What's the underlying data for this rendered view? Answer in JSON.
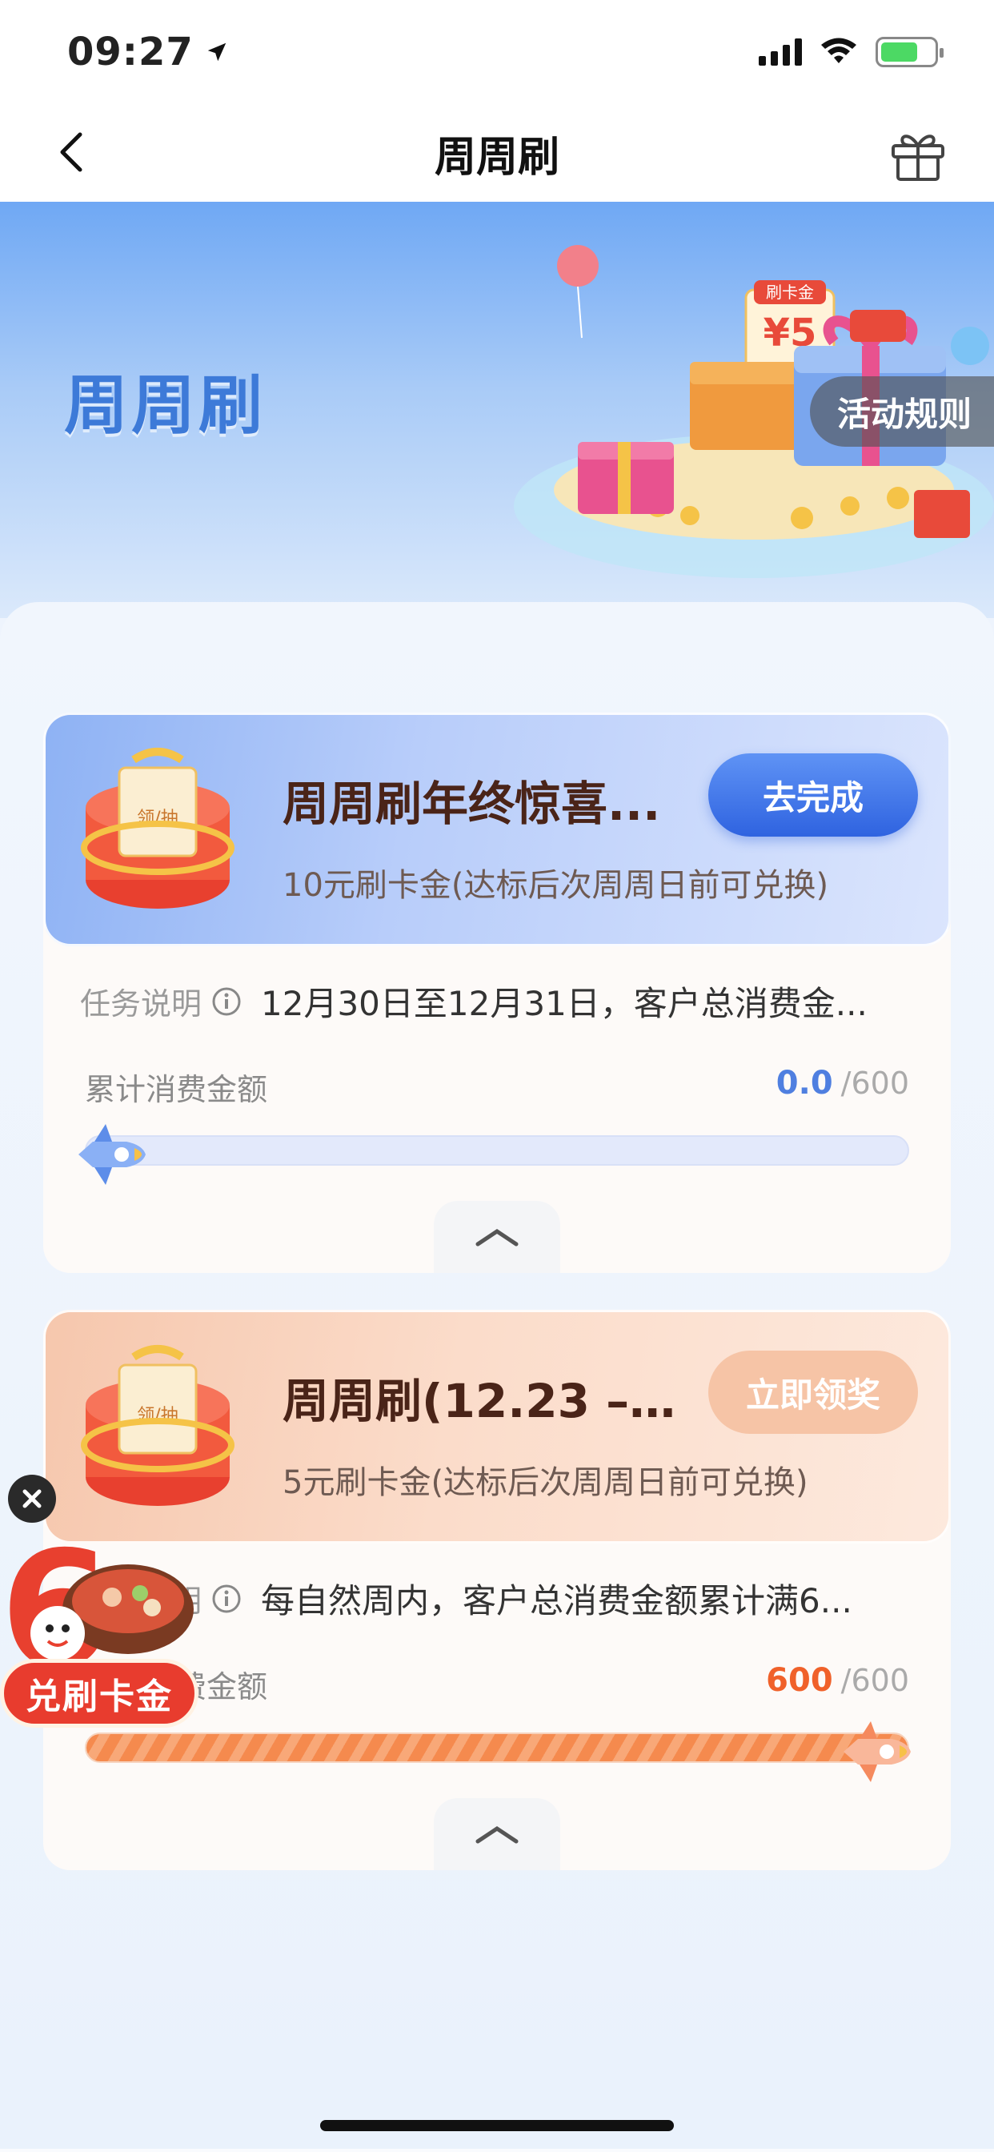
{
  "status_bar": {
    "time": "09:27"
  },
  "nav": {
    "title": "周周刷"
  },
  "hero": {
    "title": "周周刷",
    "rules_button": "活动规则",
    "art_ticket_label": "刷卡金",
    "art_amount": "¥5"
  },
  "tasks": [
    {
      "title": "周周刷年终惊喜...",
      "subtitle": "10元刷卡金(达标后次周周日前可兑换)",
      "button": "去完成",
      "desc_label": "任务说明",
      "desc_text": "12月30日至12月31日，客户总消费金...",
      "progress_label": "累计消费金额",
      "progress_current": "0.0",
      "progress_total": "/600",
      "progress_fraction": 0.0,
      "box_label": "领/抽"
    },
    {
      "title": "周周刷(12.23 – 1...",
      "subtitle": "5元刷卡金(达标后次周周日前可兑换)",
      "button": "立即领奖",
      "desc_label": "任务说明",
      "desc_text": "每自然周内，客户总消费金额累计满6...",
      "progress_label": "累计消费金额",
      "progress_current": "600",
      "progress_total": "/600",
      "progress_fraction": 1.0,
      "box_label": "领/抽"
    }
  ],
  "floating": {
    "badge": "兑刷卡金",
    "number": "6"
  },
  "colors": {
    "accent_blue": "#2f63e0",
    "accent_orange": "#f0612a"
  }
}
